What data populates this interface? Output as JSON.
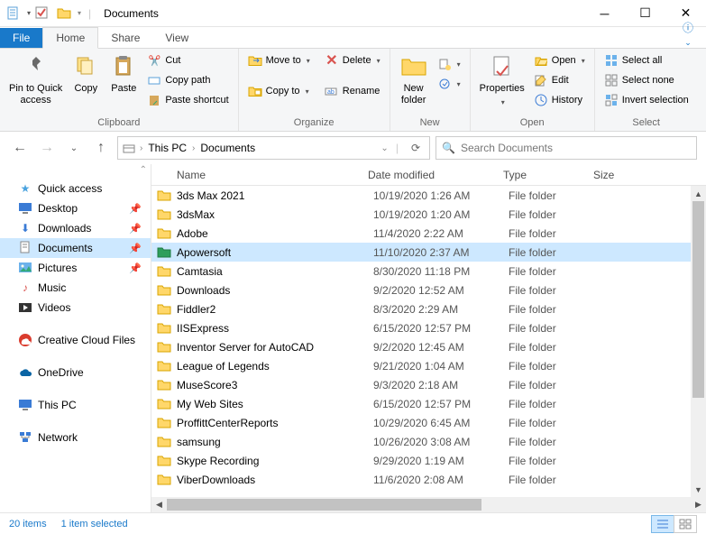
{
  "window": {
    "title": "Documents"
  },
  "tabs": {
    "file": "File",
    "home": "Home",
    "share": "Share",
    "view": "View"
  },
  "ribbon": {
    "pin_to_quick": "Pin to Quick\naccess",
    "copy": "Copy",
    "paste": "Paste",
    "cut": "Cut",
    "copy_path": "Copy path",
    "paste_shortcut": "Paste shortcut",
    "clipboard": "Clipboard",
    "move_to": "Move to",
    "copy_to": "Copy to",
    "delete": "Delete",
    "rename": "Rename",
    "organize": "Organize",
    "new_folder": "New\nfolder",
    "new": "New",
    "properties": "Properties",
    "open": "Open",
    "edit": "Edit",
    "history": "History",
    "open_group": "Open",
    "select_all": "Select all",
    "select_none": "Select none",
    "invert_selection": "Invert selection",
    "select": "Select"
  },
  "breadcrumb": {
    "root": "This PC",
    "current": "Documents"
  },
  "search": {
    "placeholder": "Search Documents"
  },
  "sidebar": {
    "quick_access": "Quick access",
    "desktop": "Desktop",
    "downloads": "Downloads",
    "documents": "Documents",
    "pictures": "Pictures",
    "music": "Music",
    "videos": "Videos",
    "creative_cloud": "Creative Cloud Files",
    "onedrive": "OneDrive",
    "this_pc": "This PC",
    "network": "Network"
  },
  "columns": {
    "name": "Name",
    "date": "Date modified",
    "type": "Type",
    "size": "Size"
  },
  "files": [
    {
      "name": "3ds Max 2021",
      "date": "10/19/2020 1:26 AM",
      "type": "File folder",
      "icon": "yellow"
    },
    {
      "name": "3dsMax",
      "date": "10/19/2020 1:20 AM",
      "type": "File folder",
      "icon": "yellow"
    },
    {
      "name": "Adobe",
      "date": "11/4/2020 2:22 AM",
      "type": "File folder",
      "icon": "yellow"
    },
    {
      "name": "Apowersoft",
      "date": "11/10/2020 2:37 AM",
      "type": "File folder",
      "icon": "green",
      "selected": true
    },
    {
      "name": "Camtasia",
      "date": "8/30/2020 11:18 PM",
      "type": "File folder",
      "icon": "yellow"
    },
    {
      "name": "Downloads",
      "date": "9/2/2020 12:52 AM",
      "type": "File folder",
      "icon": "yellow"
    },
    {
      "name": "Fiddler2",
      "date": "8/3/2020 2:29 AM",
      "type": "File folder",
      "icon": "yellow"
    },
    {
      "name": "IISExpress",
      "date": "6/15/2020 12:57 PM",
      "type": "File folder",
      "icon": "yellow"
    },
    {
      "name": "Inventor Server for AutoCAD",
      "date": "9/2/2020 12:45 AM",
      "type": "File folder",
      "icon": "yellow"
    },
    {
      "name": "League of Legends",
      "date": "9/21/2020 1:04 AM",
      "type": "File folder",
      "icon": "yellow"
    },
    {
      "name": "MuseScore3",
      "date": "9/3/2020 2:18 AM",
      "type": "File folder",
      "icon": "yellow"
    },
    {
      "name": "My Web Sites",
      "date": "6/15/2020 12:57 PM",
      "type": "File folder",
      "icon": "yellow"
    },
    {
      "name": "ProffittCenterReports",
      "date": "10/29/2020 6:45 AM",
      "type": "File folder",
      "icon": "yellow"
    },
    {
      "name": "samsung",
      "date": "10/26/2020 3:08 AM",
      "type": "File folder",
      "icon": "yellow"
    },
    {
      "name": "Skype Recording",
      "date": "9/29/2020 1:19 AM",
      "type": "File folder",
      "icon": "yellow"
    },
    {
      "name": "ViberDownloads",
      "date": "11/6/2020 2:08 AM",
      "type": "File folder",
      "icon": "yellow"
    }
  ],
  "status": {
    "count": "20 items",
    "selection": "1 item selected"
  }
}
